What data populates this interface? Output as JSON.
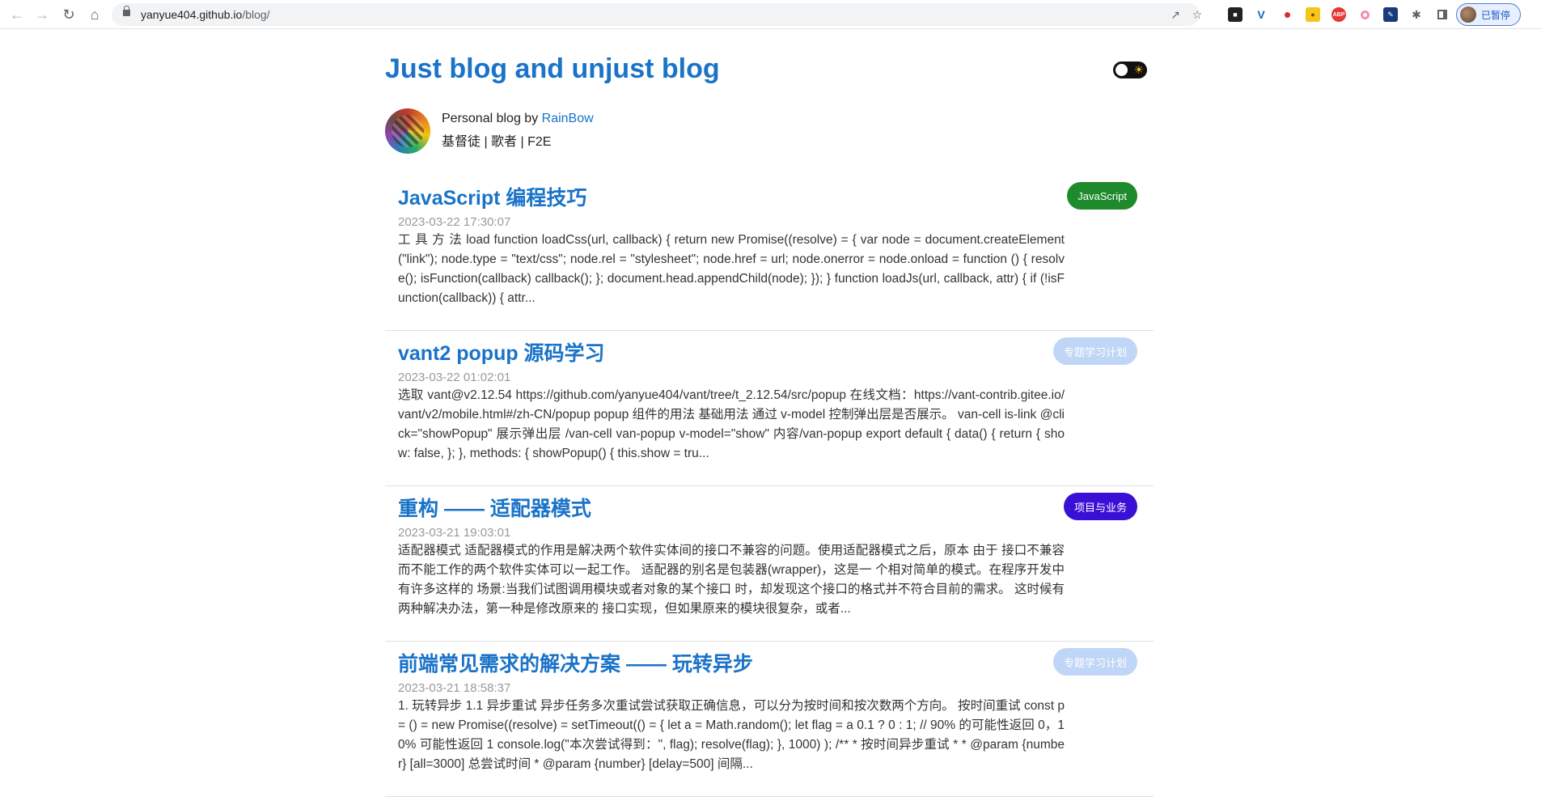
{
  "browser": {
    "url_host": "yanyue404.github.io",
    "url_path": "/blog/",
    "profile_label": "已暂停",
    "extensions": [
      "ext-1-icon",
      "ext-2-icon",
      "ext-3-icon",
      "ext-4-icon",
      "abp-icon",
      "ext-6-icon",
      "ext-7-icon",
      "puzzle-icon"
    ]
  },
  "site": {
    "title": "Just blog and unjust blog",
    "author_prefix": "Personal blog by ",
    "author_name": "RainBow",
    "author_bio": "基督徒 | 歌者 | F2E"
  },
  "posts": [
    {
      "title": "JavaScript 编程技巧",
      "date": "2023-03-22 17:30:07",
      "excerpt": "工 具 方 法  load function loadCss(url, callback) { return new Promise((resolve) = { var node = document.createElement(\"link\"); node.type = \"text/css\"; node.rel = \"stylesheet\"; node.href = url; node.onerror = node.onload = function () { resolve(); isFunction(callback) callback(); }; document.head.appendChild(node); }); } function loadJs(url, callback, attr) { if (!isFunction(callback)) { attr...",
      "tag": "JavaScript",
      "tag_color": "#1e8a2c"
    },
    {
      "title": "vant2 popup 源码学习",
      "date": "2023-03-22 01:02:01",
      "excerpt": "选取 vant@v2.12.54 https://github.com/yanyue404/vant/tree/t_2.12.54/src/popup 在线文档：https://vant-contrib.gitee.io/vant/v2/mobile.html#/zh-CN/popup popup 组件的用法 基础用法 通过 v-model 控制弹出层是否展示。 van-cell is-link @click=\"showPopup\" 展示弹出层 /van-cell van-popup v-model=\"show\" 内容/van-popup export default { data() { return { show: false, }; }, methods: { showPopup() { this.show = tru...",
      "tag": "专题学习计划",
      "tag_color": "#bfd6f6"
    },
    {
      "title": "重构 —— 适配器模式",
      "date": "2023-03-21 19:03:01",
      "excerpt": "适配器模式 适配器模式的作用是解决两个软件实体间的接口不兼容的问题。使用适配器模式之后，原本 由于 接口不兼容而不能工作的两个软件实体可以一起工作。 适配器的别名是包装器(wrapper)，这是一 个相对简单的模式。在程序开发中有许多这样的 场景:当我们试图调用模块或者对象的某个接口 时，却发现这个接口的格式并不符合目前的需求。 这时候有两种解决办法，第一种是修改原来的 接口实现，但如果原来的模块很复杂，或者...",
      "tag": "项目与业务",
      "tag_color": "#3a10d6"
    },
    {
      "title": "前端常见需求的解决方案 —— 玩转异步",
      "date": "2023-03-21 18:58:37",
      "excerpt": "1. 玩转异步 1.1 异步重试 异步任务多次重试尝试获取正确信息，可以分为按时间和按次数两个方向。 按时间重试 const p = () = new Promise((resolve) = setTimeout(() = { let a = Math.random(); let flag = a 0.1 ? 0 : 1; // 90% 的可能性返回 0，10% 可能性返回 1 console.log(\"本次尝试得到：\", flag); resolve(flag); }, 1000) ); /** * 按时间异步重试 * * @param {number} [all=3000] 总尝试时间 * @param {number} [delay=500] 间隔...",
      "tag": "专题学习计划",
      "tag_color": "#bfd6f6"
    }
  ]
}
